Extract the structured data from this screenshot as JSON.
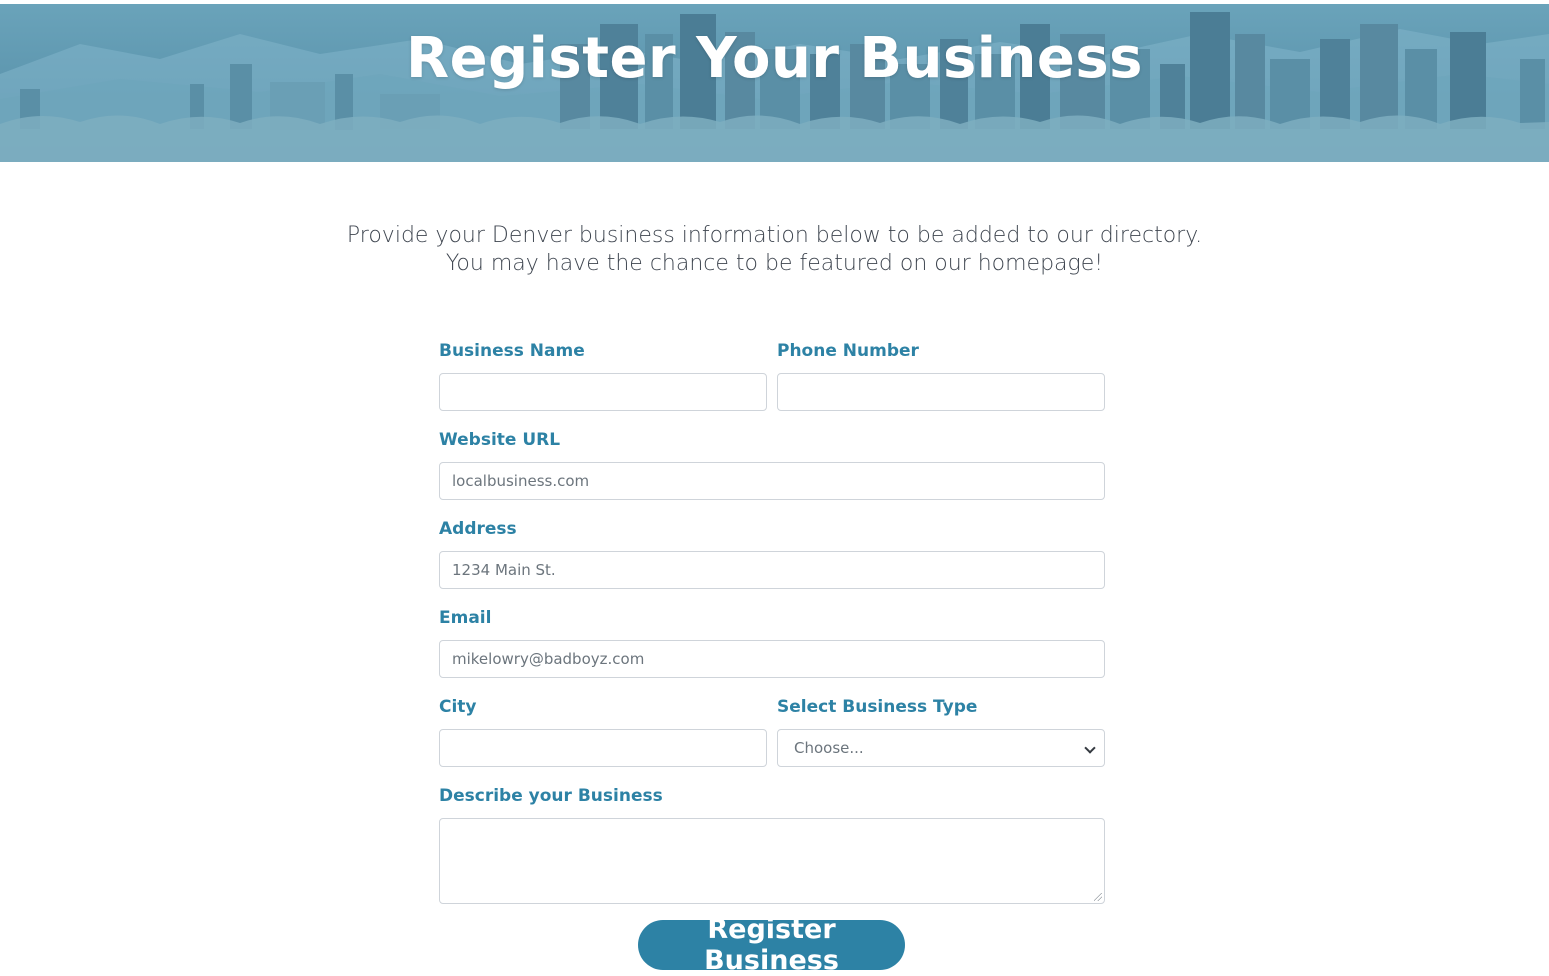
{
  "hero": {
    "title": "Register Your Business"
  },
  "intro": {
    "line1": "Provide your Denver business information below to be added to our directory.",
    "line2": "You may have the chance to be featured on our homepage!"
  },
  "form": {
    "business_name": {
      "label": "Business Name",
      "value": "",
      "placeholder": ""
    },
    "phone_number": {
      "label": "Phone Number",
      "value": "",
      "placeholder": ""
    },
    "website_url": {
      "label": "Website URL",
      "value": "",
      "placeholder": "localbusiness.com"
    },
    "address": {
      "label": "Address",
      "value": "",
      "placeholder": "1234 Main St."
    },
    "email": {
      "label": "Email",
      "value": "",
      "placeholder": "mikelowry@badboyz.com"
    },
    "city": {
      "label": "City",
      "value": "",
      "placeholder": ""
    },
    "business_type": {
      "label": "Select Business Type",
      "selected": "Choose..."
    },
    "description": {
      "label": "Describe your Business",
      "value": ""
    },
    "submit_label": "Register Business"
  },
  "colors": {
    "accent": "#2d82a5",
    "hero_tint": "#5f98b0",
    "text": "#3f4650"
  }
}
